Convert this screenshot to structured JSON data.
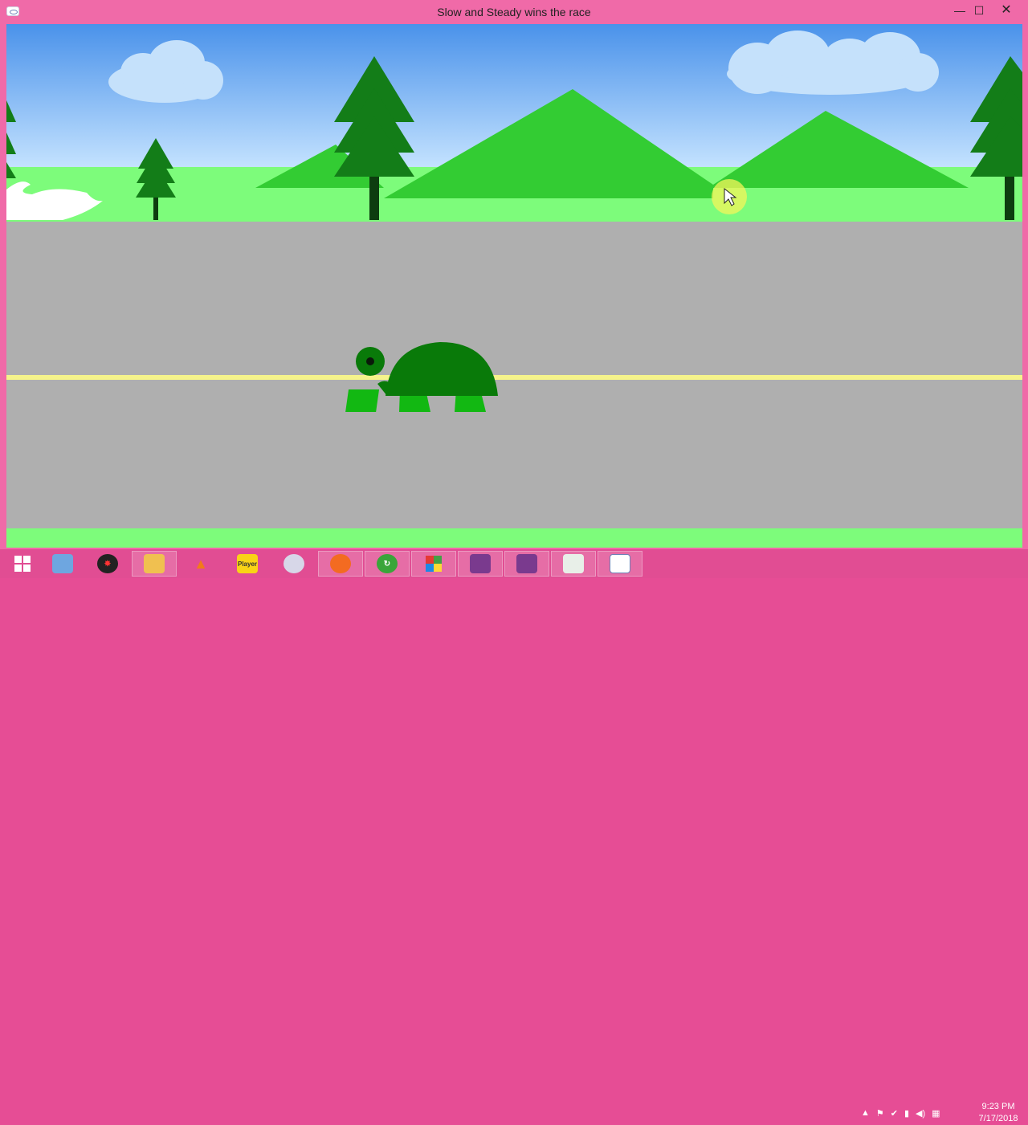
{
  "window": {
    "title": "Slow and Steady wins the race",
    "minimize": "—",
    "maximize": "☐",
    "close": "✕"
  },
  "scene": {
    "sky_top": "#4a92ea",
    "sky_bottom": "#c5e3ff",
    "grass": "#7dfc7b",
    "road": "#afafaf",
    "road_line": "#f5f38b",
    "mountain": "#33cc33",
    "tree": "#137d18",
    "tortoise": "#097a09",
    "tortoise_legs": "#12b812"
  },
  "taskbar": {
    "icons": [
      {
        "name": "windows-start-icon",
        "label": ""
      },
      {
        "name": "file-explorer-icon",
        "label": ""
      },
      {
        "name": "settings-web-icon",
        "label": ""
      },
      {
        "name": "folder-icon",
        "label": ""
      },
      {
        "name": "matlab-icon",
        "label": ""
      },
      {
        "name": "player-icon",
        "label": "Player"
      },
      {
        "name": "snipping-tool-icon",
        "label": ""
      },
      {
        "name": "firefox-icon",
        "label": ""
      },
      {
        "name": "camtasia-icon",
        "label": ""
      },
      {
        "name": "visual-studio-icon",
        "label": ""
      },
      {
        "name": "recorder-icon",
        "label": ""
      },
      {
        "name": "video-editor-icon",
        "label": ""
      },
      {
        "name": "notes-icon",
        "label": ""
      },
      {
        "name": "opengl-app-icon",
        "label": ""
      }
    ],
    "tray": [
      "▲",
      "⚑",
      "✔",
      "▮",
      "◀)",
      "▦"
    ],
    "time": "9:23 PM",
    "date": "7/17/2018"
  }
}
